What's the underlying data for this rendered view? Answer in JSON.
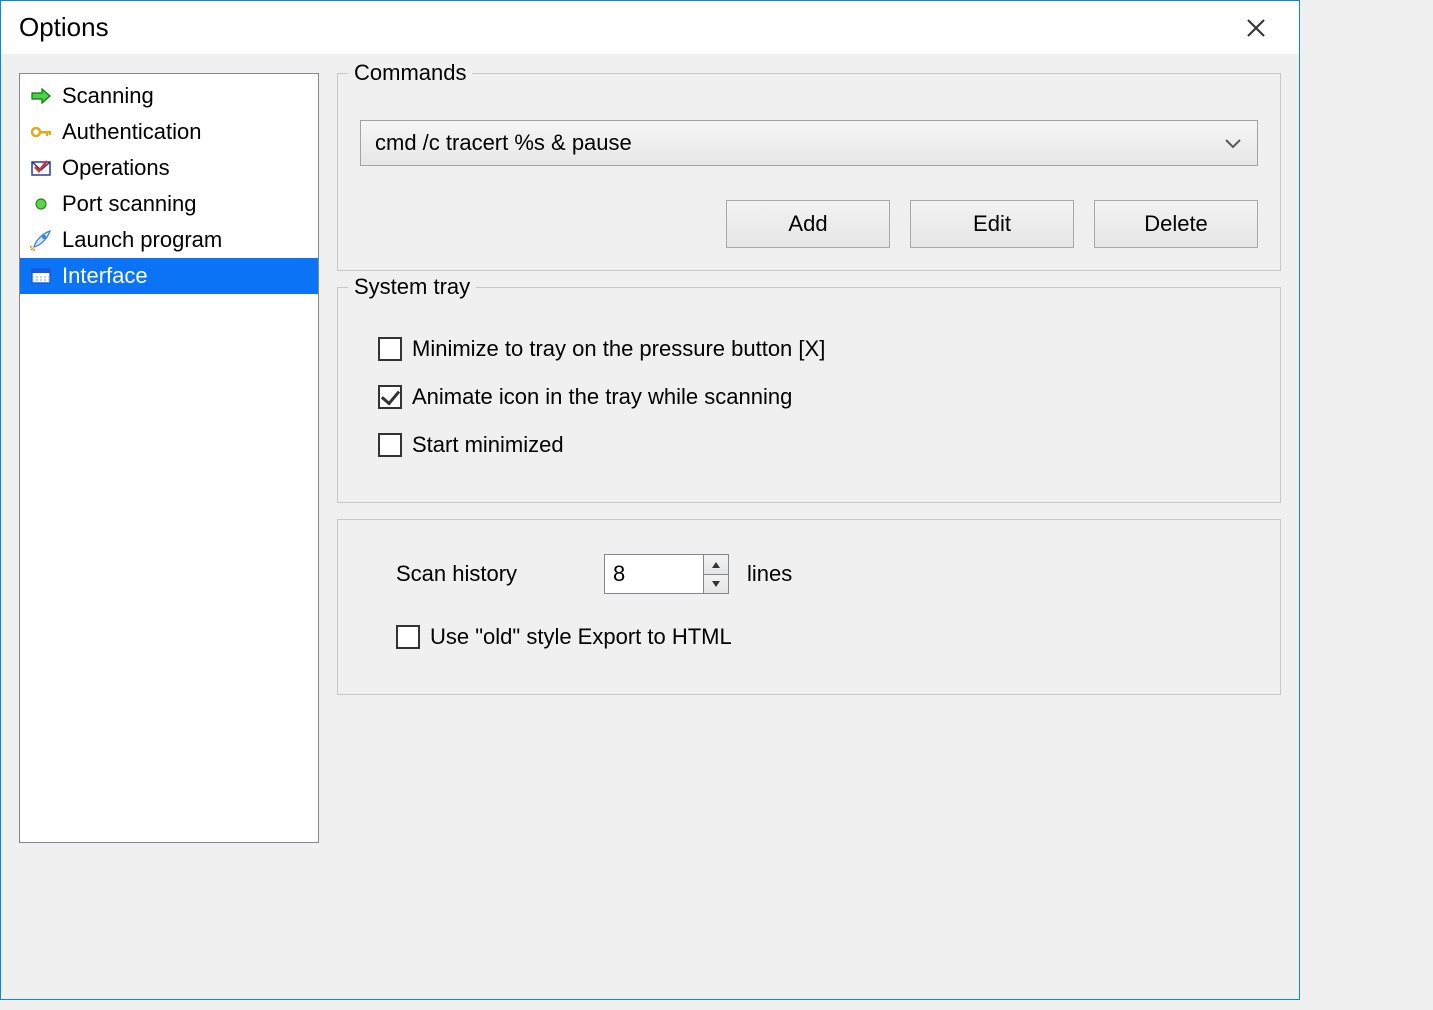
{
  "window": {
    "title": "Options"
  },
  "sidebar": {
    "items": [
      {
        "label": "Scanning"
      },
      {
        "label": "Authentication"
      },
      {
        "label": "Operations"
      },
      {
        "label": "Port scanning"
      },
      {
        "label": "Launch program"
      },
      {
        "label": "Interface"
      }
    ],
    "selected_index": 5
  },
  "commands": {
    "legend": "Commands",
    "selected": "cmd /c tracert %s & pause",
    "buttons": {
      "add": "Add",
      "edit": "Edit",
      "delete": "Delete"
    }
  },
  "systray": {
    "legend": "System tray",
    "minimize_on_close": {
      "label": "Minimize to tray on the pressure button [X]",
      "checked": false
    },
    "animate_icon": {
      "label": "Animate icon in the tray while scanning",
      "checked": true
    },
    "start_minimized": {
      "label": "Start minimized",
      "checked": false
    }
  },
  "misc": {
    "scan_history_label": "Scan history",
    "scan_history_value": "8",
    "scan_history_unit": "lines",
    "use_old_export": {
      "label": "Use \"old\" style Export to HTML",
      "checked": false
    }
  }
}
